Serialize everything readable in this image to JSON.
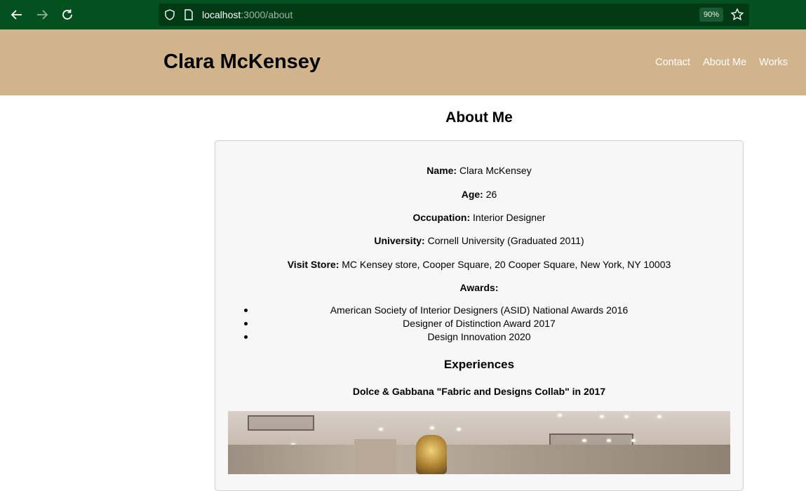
{
  "browser": {
    "url_host": "localhost",
    "url_path": ":3000/about",
    "zoom": "90%"
  },
  "site": {
    "title": "Clara McKensey",
    "nav": [
      "Contact",
      "About Me",
      "Works"
    ]
  },
  "about": {
    "heading": "About Me",
    "name_label": "Name:",
    "name_value": "Clara McKensey",
    "age_label": "Age:",
    "age_value": "26",
    "occupation_label": "Occupation:",
    "occupation_value": "Interior Designer",
    "university_label": "University:",
    "university_value": "Cornell University (Graduated 2011)",
    "store_label": "Visit Store:",
    "store_value": "MC Kensey store, Cooper Square, 20 Cooper Square, New York, NY 10003",
    "awards_label": "Awards:",
    "awards": [
      "American Society of Interior Designers (ASID) National Awards 2016",
      "Designer of Distinction Award 2017",
      "Design Innovation 2020"
    ],
    "experiences_heading": "Experiences",
    "experience_item": "Dolce & Gabbana \"Fabric and Designs Collab\" in 2017"
  }
}
